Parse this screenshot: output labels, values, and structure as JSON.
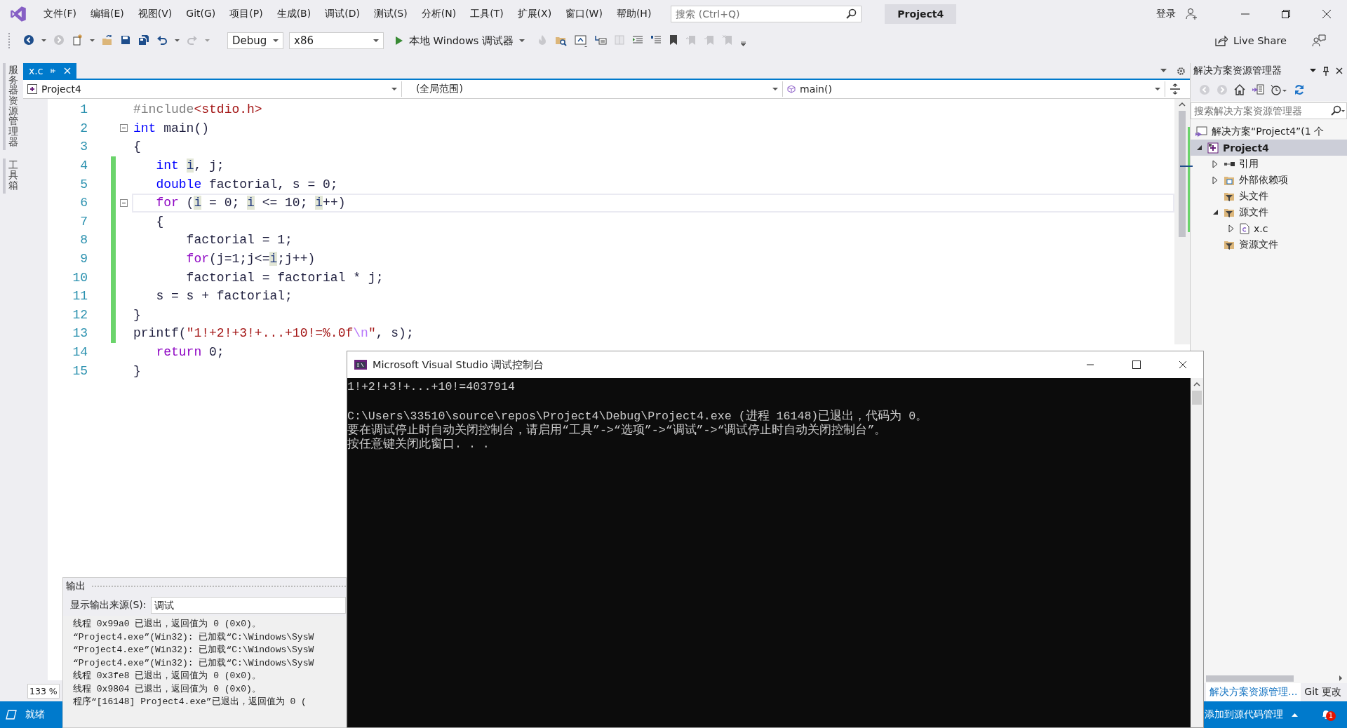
{
  "menu_bar": {
    "items": [
      "文件(F)",
      "编辑(E)",
      "视图(V)",
      "Git(G)",
      "项目(P)",
      "生成(B)",
      "调试(D)",
      "测试(S)",
      "分析(N)",
      "工具(T)",
      "扩展(X)",
      "窗口(W)",
      "帮助(H)"
    ],
    "search": {
      "placeholder": "搜索 (Ctrl+Q)"
    },
    "project_title": "Project4",
    "sign_in": "登录"
  },
  "toolbar": {
    "configuration": "Debug",
    "platform": "x86",
    "debugger": "本地 Windows 调试器",
    "live_share": "Live Share"
  },
  "side_tabs": [
    "服务器资源管理器",
    "工具箱"
  ],
  "editor": {
    "tabs": [
      {
        "label": "x.c",
        "selected": true
      }
    ],
    "nav": {
      "project": "Project4",
      "scope": "(全局范围)",
      "member": "main()"
    },
    "lines": [
      {
        "number": "1",
        "changed": false,
        "fold": false,
        "current": false,
        "tokens": [
          {
            "kind": "preproc",
            "text": "#include"
          },
          {
            "kind": "string",
            "text": "<stdio.h>"
          }
        ]
      },
      {
        "number": "2",
        "changed": false,
        "fold": true,
        "current": false,
        "tokens": [
          {
            "kind": "keyword",
            "text": "int"
          },
          {
            "kind": "plain",
            "text": " main()"
          }
        ]
      },
      {
        "number": "3",
        "changed": false,
        "fold": false,
        "current": false,
        "tokens": [
          {
            "kind": "plain",
            "text": "{"
          }
        ]
      },
      {
        "number": "4",
        "changed": true,
        "fold": false,
        "current": false,
        "tokens": [
          {
            "kind": "keyword",
            "text": "   int "
          },
          {
            "kind": "ref",
            "text": "i"
          },
          {
            "kind": "plain",
            "text": ", j;"
          }
        ]
      },
      {
        "number": "5",
        "changed": true,
        "fold": false,
        "current": false,
        "tokens": [
          {
            "kind": "keyword",
            "text": "   double"
          },
          {
            "kind": "plain",
            "text": " factorial, s = 0;"
          }
        ]
      },
      {
        "number": "6",
        "changed": true,
        "fold": true,
        "current": true,
        "tokens": [
          {
            "kind": "control",
            "text": "   for"
          },
          {
            "kind": "plain",
            "text": " ("
          },
          {
            "kind": "ref",
            "text": "i"
          },
          {
            "kind": "plain",
            "text": " = 0; "
          },
          {
            "kind": "ref",
            "text": "i"
          },
          {
            "kind": "plain",
            "text": " <= 10; "
          },
          {
            "kind": "ref",
            "text": "i"
          },
          {
            "kind": "plain",
            "text": "++)"
          }
        ]
      },
      {
        "number": "7",
        "changed": true,
        "fold": false,
        "current": false,
        "tokens": [
          {
            "kind": "plain",
            "text": "   {"
          }
        ]
      },
      {
        "number": "8",
        "changed": true,
        "fold": false,
        "current": false,
        "tokens": [
          {
            "kind": "plain",
            "text": "       factorial = 1;"
          }
        ]
      },
      {
        "number": "9",
        "changed": true,
        "fold": false,
        "current": false,
        "tokens": [
          {
            "kind": "control",
            "text": "       for"
          },
          {
            "kind": "plain",
            "text": "(j=1;j<="
          },
          {
            "kind": "ref",
            "text": "i"
          },
          {
            "kind": "plain",
            "text": ";j++)"
          }
        ]
      },
      {
        "number": "10",
        "changed": true,
        "fold": false,
        "current": false,
        "tokens": [
          {
            "kind": "plain",
            "text": "       factorial = factorial * j;"
          }
        ]
      },
      {
        "number": "11",
        "changed": true,
        "fold": false,
        "current": false,
        "tokens": [
          {
            "kind": "plain",
            "text": "   s = s + factorial;"
          }
        ]
      },
      {
        "number": "12",
        "changed": true,
        "fold": false,
        "current": false,
        "tokens": [
          {
            "kind": "plain",
            "text": "}"
          }
        ]
      },
      {
        "number": "13",
        "changed": true,
        "fold": false,
        "current": false,
        "tokens": [
          {
            "kind": "plain",
            "text": "printf("
          },
          {
            "kind": "string",
            "text": "\"1!+2!+3!+...+10!=%.0f"
          },
          {
            "kind": "escape",
            "text": "\\n"
          },
          {
            "kind": "string",
            "text": "\""
          },
          {
            "kind": "plain",
            "text": ", s);"
          }
        ]
      },
      {
        "number": "14",
        "changed": false,
        "fold": false,
        "current": false,
        "tokens": [
          {
            "kind": "control",
            "text": "   return"
          },
          {
            "kind": "plain",
            "text": " 0;"
          }
        ]
      },
      {
        "number": "15",
        "changed": false,
        "fold": false,
        "current": false,
        "tokens": [
          {
            "kind": "plain",
            "text": "}"
          }
        ]
      }
    ],
    "zoom": "133 %"
  },
  "output_panel": {
    "title": "输出",
    "source_label": "显示输出来源(S):",
    "source": "调试",
    "lines": [
      "线程 0x99a0 已退出，返回值为 0 (0x0)。",
      "“Project4.exe”(Win32): 已加载“C:\\Windows\\SysW",
      "“Project4.exe”(Win32): 已加载“C:\\Windows\\SysW",
      "“Project4.exe”(Win32): 已加载“C:\\Windows\\SysW",
      "线程 0x3fe8 已退出，返回值为 0 (0x0)。",
      "线程 0x9804 已退出，返回值为 0 (0x0)。",
      "程序“[16148] Project4.exe”已退出，返回值为 0 ("
    ]
  },
  "console": {
    "title": "Microsoft Visual Studio 调试控制台",
    "paragraphs": [
      [
        "1!+2!+3!+...+10!=4037914"
      ],
      [
        "C:\\Users\\33510\\source\\repos\\Project4\\Debug\\Project4.exe (进程 16148)已退出，代码为 0。",
        "要在调试停止时自动关闭控制台，请启用“工具”->“选项”->“调试”->“调试停止时自动关闭控制台”。",
        "按任意键关闭此窗口. . ."
      ]
    ]
  },
  "solution_explorer": {
    "title": "解决方案资源管理器",
    "search": {
      "placeholder": "搜索解决方案资源管理器"
    },
    "tree": [
      {
        "label": "解决方案“Project4”(1 个",
        "kind": "solution",
        "expandable": false,
        "selected": false,
        "children": [
          {
            "label": "Project4",
            "kind": "project",
            "expandable": true,
            "expanded": true,
            "selected": true,
            "children": [
              {
                "label": "引用",
                "kind": "references",
                "expandable": true,
                "expanded": false,
                "selected": false
              },
              {
                "label": "外部依赖项",
                "kind": "external",
                "expandable": true,
                "expanded": false,
                "selected": false
              },
              {
                "label": "头文件",
                "kind": "filter",
                "expandable": false,
                "selected": false
              },
              {
                "label": "源文件",
                "kind": "filter",
                "expandable": true,
                "expanded": true,
                "selected": false,
                "children": [
                  {
                    "label": "x.c",
                    "kind": "file",
                    "expandable": true,
                    "expanded": false,
                    "selected": false
                  }
                ]
              },
              {
                "label": "资源文件",
                "kind": "filter",
                "expandable": false,
                "selected": false
              }
            ]
          }
        ]
      }
    ],
    "tabs": [
      {
        "label": "解决方案资源管理...",
        "selected": true
      },
      {
        "label": "Git 更改",
        "selected": false
      }
    ]
  },
  "status_bar": {
    "status": "就绪",
    "source_control": "添加到源代码管理",
    "notifications": "1"
  }
}
